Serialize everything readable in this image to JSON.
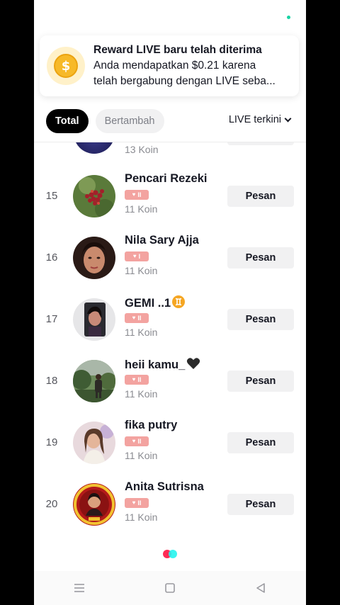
{
  "toast": {
    "icon": "dollar-coin-icon",
    "coin_symbol": "$",
    "title": "Reward LIVE baru telah diterima",
    "body_line1": "Anda mendapatkan $0.21 karena",
    "body_line2": "telah bergabung dengan LIVE seba..."
  },
  "tabs": [
    {
      "label": "Total",
      "active": true
    },
    {
      "label": "Bertambah",
      "active": false
    }
  ],
  "sort": {
    "label": "LIVE terkini",
    "icon": "chevron-down-icon"
  },
  "partial_row": {
    "coins": "13 Koin"
  },
  "rows": [
    {
      "rank": "15",
      "name": "Pencari Rezeki",
      "emoji": "",
      "level": "II",
      "coins": "11 Koin",
      "button": "Pesan"
    },
    {
      "rank": "16",
      "name": "Nila Sary Ajja",
      "emoji": "",
      "level": "I",
      "coins": "11 Koin",
      "button": "Pesan"
    },
    {
      "rank": "17",
      "name": "GEMI ..1",
      "emoji": "gemini-zodiac-icon",
      "level": "II",
      "coins": "11 Koin",
      "button": "Pesan"
    },
    {
      "rank": "18",
      "name": "heii kamu_",
      "emoji": "black-heart-icon",
      "level": "II",
      "coins": "11 Koin",
      "button": "Pesan"
    },
    {
      "rank": "19",
      "name": "fika putry",
      "emoji": "",
      "level": "II",
      "coins": "11 Koin",
      "button": "Pesan"
    },
    {
      "rank": "20",
      "name": "Anita Sutrisna",
      "emoji": "",
      "level": "II",
      "coins": "11 Koin",
      "button": "Pesan"
    }
  ],
  "nav": {
    "menu": "menu-icon",
    "home": "home-square-icon",
    "back": "back-triangle-icon"
  }
}
